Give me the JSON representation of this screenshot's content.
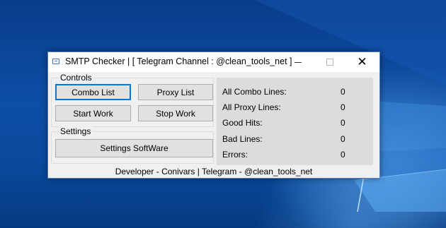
{
  "window": {
    "title": "SMTP Checker | [ Telegram Channel : @clean_tools_net ]",
    "close_glyph": "✕",
    "icon": "app-window-icon"
  },
  "controls": {
    "group_label": "Controls",
    "combo_list": "Combo List",
    "proxy_list": "Proxy List",
    "start_work": "Start Work",
    "stop_work": "Stop Work"
  },
  "settings": {
    "group_label": "Settings",
    "settings_software": "Settings SoftWare"
  },
  "stats": [
    {
      "label": "All Combo Lines:",
      "value": "0"
    },
    {
      "label": "All Proxy Lines:",
      "value": "0"
    },
    {
      "label": "Good Hits:",
      "value": "0"
    },
    {
      "label": "Bad Lines:",
      "value": "0"
    },
    {
      "label": "Errors:",
      "value": "0"
    }
  ],
  "footer": "Developer - Conivars | Telegram - @clean_tools_net",
  "colors": {
    "desktop_bg": "#0b3f86",
    "window_bg": "#f0f0f0",
    "stats_bg": "#dcdcdc",
    "focus_border": "#0078d7"
  }
}
